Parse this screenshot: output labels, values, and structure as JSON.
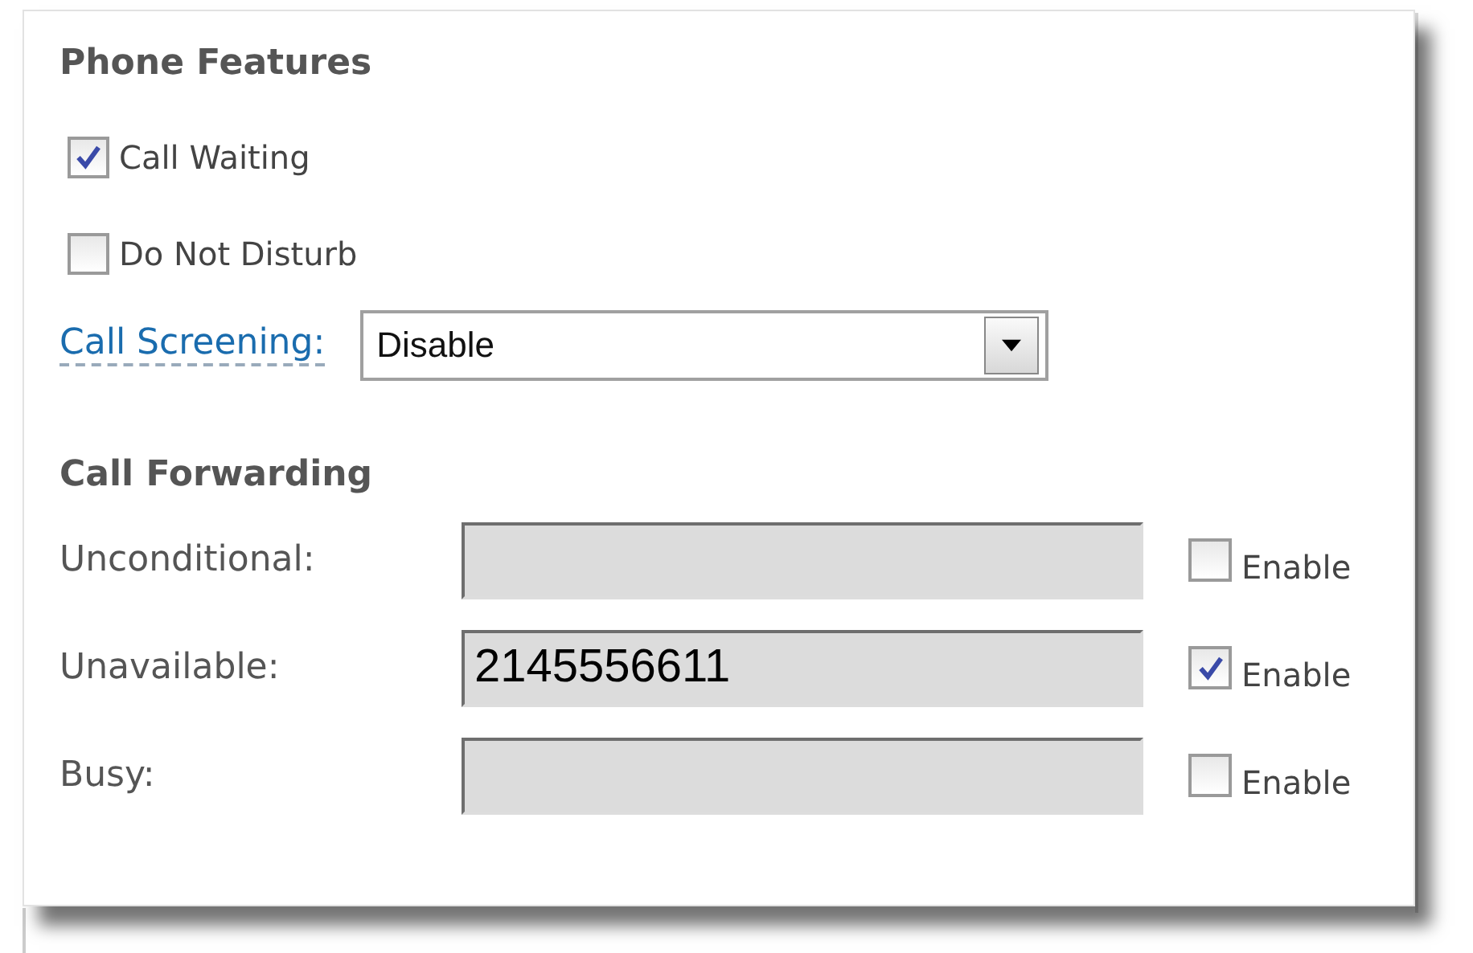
{
  "phone_features": {
    "title": "Phone Features",
    "options": [
      {
        "label": "Call Waiting",
        "checked": true
      },
      {
        "label": "Do Not Disturb",
        "checked": false
      }
    ],
    "call_screening": {
      "label": "Call Screening:",
      "value": "Disable"
    }
  },
  "call_forwarding": {
    "title": "Call Forwarding",
    "rows": [
      {
        "label": "Unconditional:",
        "value": "",
        "enable_label": "Enable",
        "checked": false
      },
      {
        "label": "Unavailable:",
        "value": "2145556611",
        "enable_label": "Enable",
        "checked": true
      },
      {
        "label": "Busy:",
        "value": "",
        "enable_label": "Enable",
        "checked": false
      }
    ]
  }
}
